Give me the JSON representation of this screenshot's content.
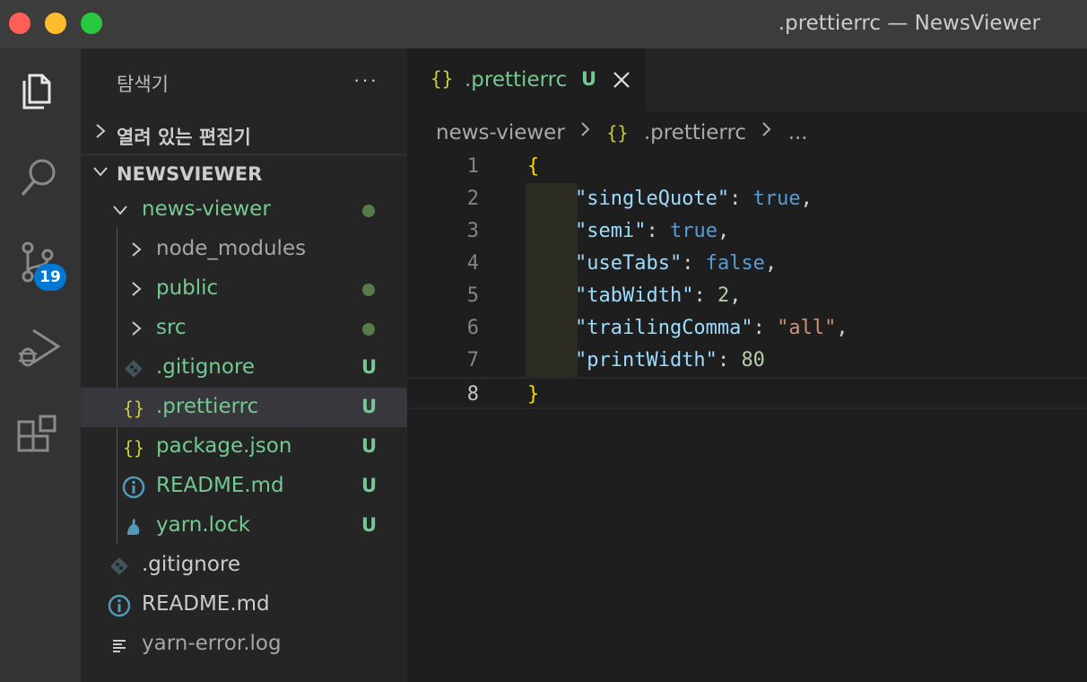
{
  "window": {
    "title": ".prettierrc — NewsViewer"
  },
  "activity_bar": {
    "items": [
      "files-icon",
      "search-icon",
      "source-control-icon",
      "run-debug-icon",
      "extensions-icon"
    ],
    "source_control_badge": "19"
  },
  "sidebar": {
    "title": "탐색기",
    "more": "···",
    "sections": {
      "open_editors": "열려 있는 편집기",
      "workspace": "NEWSVIEWER"
    },
    "tree": [
      {
        "name": "news-viewer",
        "status": ""
      },
      {
        "name": "node_modules",
        "status": ""
      },
      {
        "name": "public",
        "status": ""
      },
      {
        "name": "src",
        "status": ""
      },
      {
        "name": ".gitignore",
        "status": "U"
      },
      {
        "name": ".prettierrc",
        "status": "U"
      },
      {
        "name": "package.json",
        "status": "U"
      },
      {
        "name": "README.md",
        "status": "U"
      },
      {
        "name": "yarn.lock",
        "status": "U"
      },
      {
        "name": ".gitignore",
        "status": ""
      },
      {
        "name": "README.md",
        "status": ""
      },
      {
        "name": "yarn-error.log",
        "status": ""
      }
    ]
  },
  "editor": {
    "tab": {
      "icon": "{}",
      "label": ".prettierrc",
      "status": "U"
    },
    "breadcrumb": {
      "folder": "news-viewer",
      "file": ".prettierrc",
      "more": "..."
    },
    "lines": [
      {
        "num": "1",
        "open": "{"
      },
      {
        "num": "2",
        "key": "\"singleQuote\"",
        "value": "true"
      },
      {
        "num": "3",
        "key": "\"semi\"",
        "value": "true"
      },
      {
        "num": "4",
        "key": "\"useTabs\"",
        "value": "false"
      },
      {
        "num": "5",
        "key": "\"tabWidth\"",
        "value": "2"
      },
      {
        "num": "6",
        "key": "\"trailingComma\"",
        "value": "\"all\""
      },
      {
        "num": "7",
        "key": "\"printWidth\"",
        "value": "80"
      },
      {
        "num": "8",
        "close": "}"
      }
    ]
  },
  "colors": {
    "accent": "#0078d4",
    "untracked": "#73c991",
    "json_icon": "#cbcb41"
  }
}
